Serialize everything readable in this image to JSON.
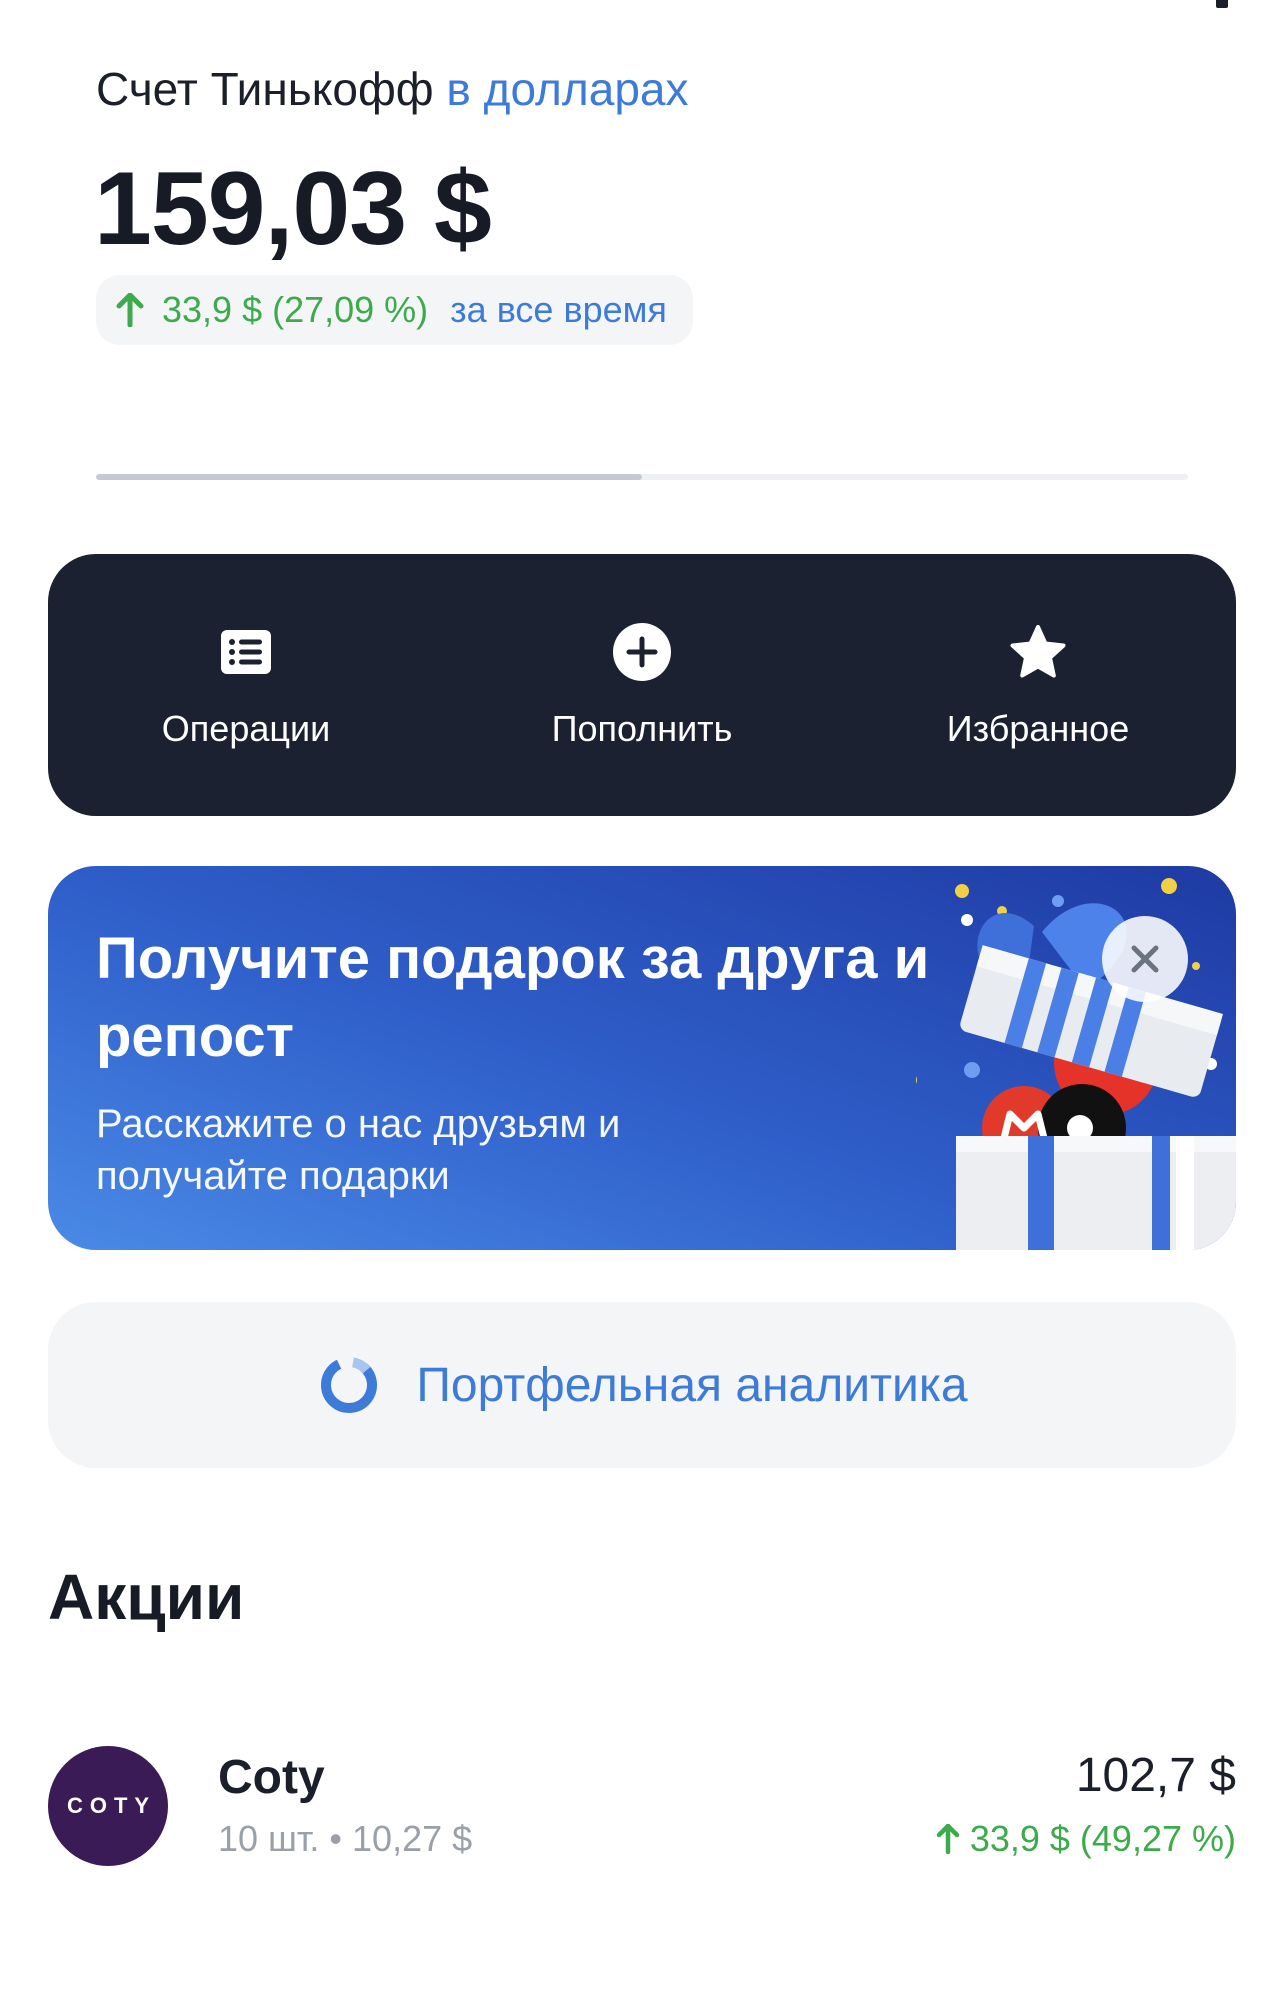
{
  "account": {
    "title_prefix": "Счет Тинькофф",
    "title_currency": "в долларах",
    "balance": "159,03 $",
    "gain": "33,9 $ (27,09 %)",
    "gain_period": "за все время"
  },
  "progress": {
    "fraction": 0.5
  },
  "actions": [
    {
      "label": "Операции",
      "icon": "list-icon"
    },
    {
      "label": "Пополнить",
      "icon": "plus-circle-icon"
    },
    {
      "label": "Избранное",
      "icon": "star-icon"
    }
  ],
  "promo": {
    "title": "Получите подарок за друга и репост",
    "text": "Расскажите о нас друзьям и получайте подарки",
    "close_icon": "close-icon"
  },
  "analytics": {
    "label": "Портфельная аналитика",
    "icon": "donut-chart-icon"
  },
  "stocks_section": {
    "title": "Акции",
    "items": [
      {
        "logo_text": "COTY",
        "name": "Coty",
        "meta": "10 шт. • 10,27 $",
        "value": "102,7 $",
        "gain": "33,9 $ (49,27 %)"
      }
    ]
  },
  "colors": {
    "accent": "#3d7bd9",
    "gain": "#3daa4b",
    "dark_panel": "#1b2130"
  }
}
